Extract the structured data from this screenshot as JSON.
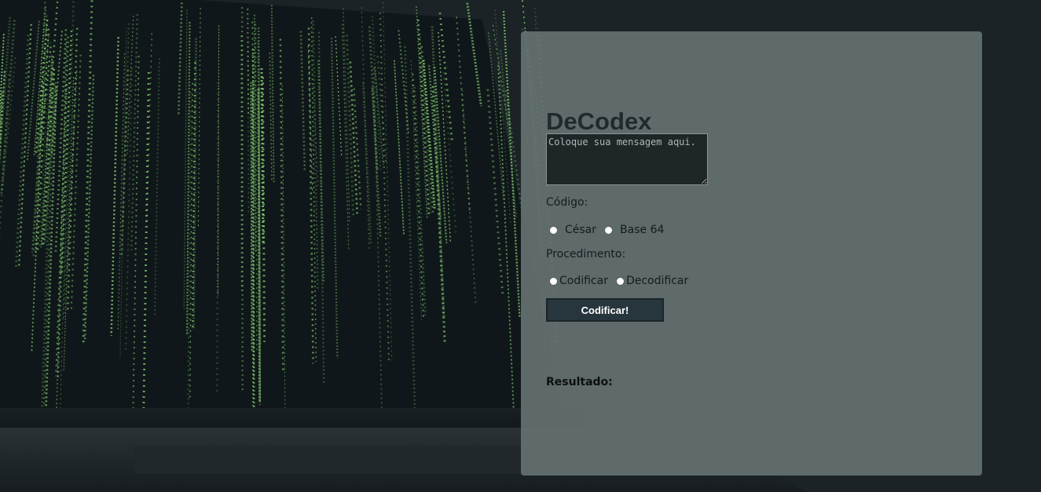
{
  "app": {
    "title": "DeCodex",
    "message_placeholder": "Coloque sua mensagem aqui.",
    "message_value": ""
  },
  "code": {
    "label": "Código:",
    "options": [
      "César",
      "Base 64"
    ]
  },
  "procedure": {
    "label": "Procedimento:",
    "options": [
      "Codificar",
      "Decodificar"
    ]
  },
  "submit_label": "Codificar!",
  "result_label": "Resultado:",
  "colors": {
    "card_bg": "#5f6a6b",
    "page_bg": "#1b2326",
    "button_bg": "#27353d",
    "matrix_green": "#7fc46b"
  }
}
